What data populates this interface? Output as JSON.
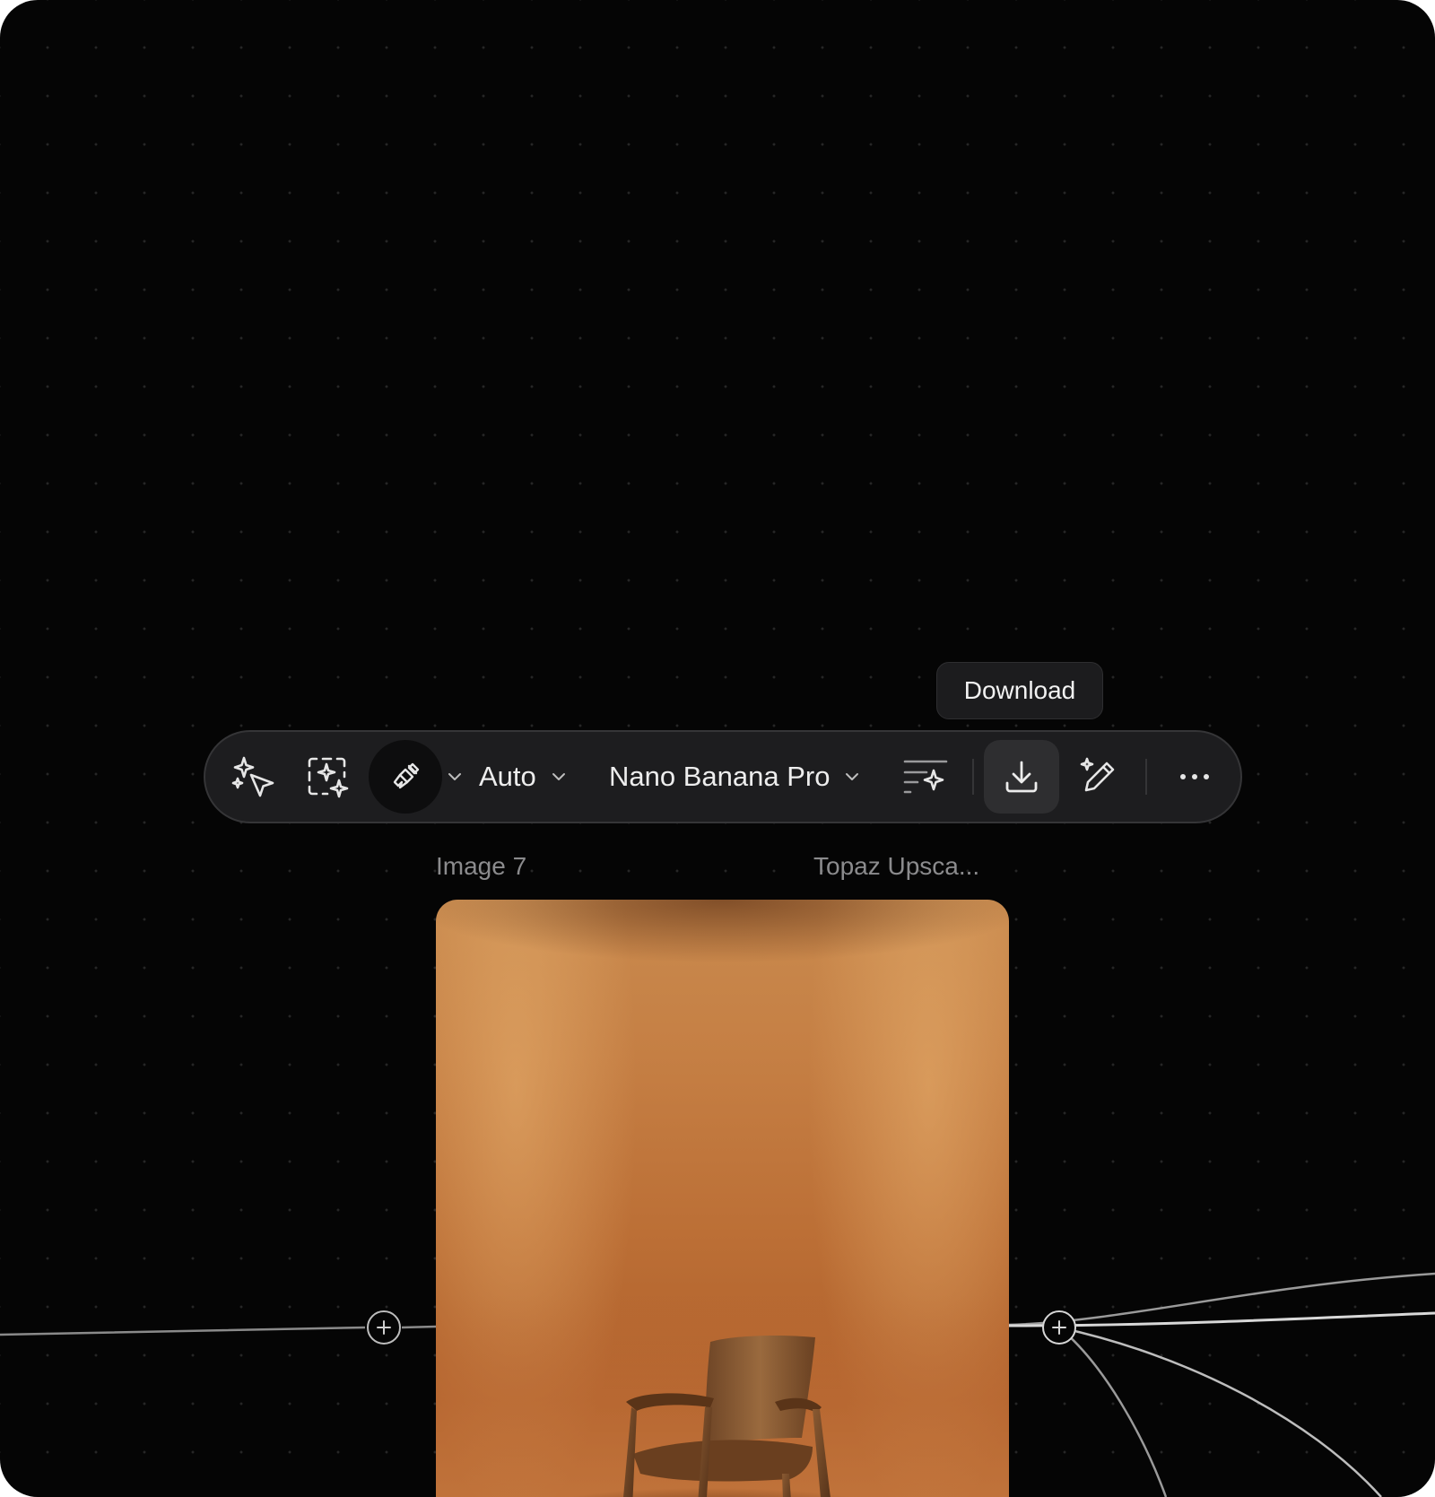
{
  "tooltip": {
    "text": "Download"
  },
  "toolbar": {
    "tools": [
      {
        "icon": "sparkle-cursor-icon"
      },
      {
        "icon": "sparkle-select-icon"
      },
      {
        "icon": "brush-icon",
        "active": true
      },
      {
        "icon": "chevron-down-icon"
      }
    ],
    "aspect": {
      "label": "Auto",
      "icon": "chevron-down-icon"
    },
    "model": {
      "label": "Nano Banana Pro",
      "icon": "chevron-down-icon"
    },
    "actions": [
      {
        "icon": "prompt-sparkle-icon"
      },
      {
        "icon": "download-icon",
        "hovered": true
      },
      {
        "icon": "edit-sparkle-icon"
      },
      {
        "icon": "more-icon"
      }
    ]
  },
  "node": {
    "title": "Image 7",
    "source": "Topaz Upsca..."
  },
  "colors": {
    "canvas": "#050505",
    "toolbar": "#1d1d1f",
    "image_warm": "#c57f44"
  }
}
